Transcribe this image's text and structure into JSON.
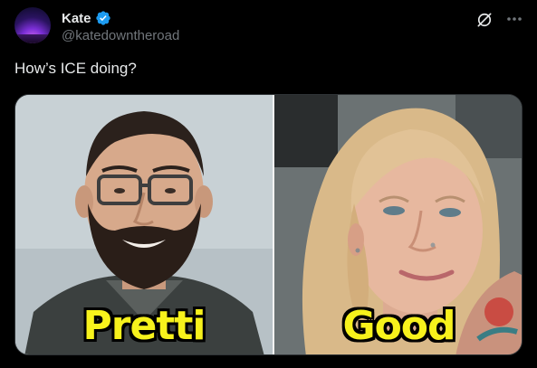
{
  "post": {
    "author": {
      "display_name": "Kate",
      "handle": "@katedowntheroad",
      "verified": true,
      "avatar_icon": "avatar-icon"
    },
    "text": "How’s ICE doing?",
    "media": {
      "left_caption": "Pretti",
      "right_caption": "Good"
    }
  },
  "icons": {
    "verified": "verified-badge-icon",
    "grok": "grok-icon",
    "more": "more-options-icon"
  },
  "colors": {
    "background": "#000000",
    "text": "#e7e9ea",
    "muted": "#71767b",
    "verified": "#1d9bf0",
    "caption": "#f7f21c"
  }
}
